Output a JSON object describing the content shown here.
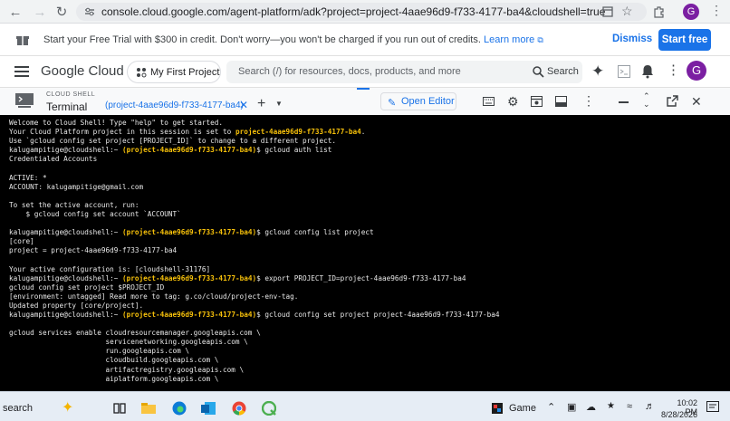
{
  "browser": {
    "url": "console.cloud.google.com/agent-platform/adk?project=project-4aae96d9-f733-4177-ba4&cloudshell=true",
    "profile_initial": "G"
  },
  "banner": {
    "text": "Start your Free Trial with $300 in credit. Don't worry—you won't be charged if you run out of credits.",
    "link": "Learn more",
    "dismiss": "Dismiss",
    "start_free": "Start free"
  },
  "header": {
    "logo": "Google Cloud",
    "project": "My First Project",
    "search_placeholder": "Search (/) for resources, docs, products, and more",
    "search_button": "Search",
    "avatar": "G"
  },
  "shell": {
    "section_label": "CLOUD SHELL",
    "title": "Terminal",
    "tab": "(project-4aae96d9-f733-4177-ba4)",
    "open_editor": "Open Editor"
  },
  "terminal": {
    "l01": "Welcome to Cloud Shell! Type \"help\" to get started.",
    "l02a": "Your Cloud Platform project in this session is set to ",
    "l02b": "project-4aae96d9-f733-4177-ba4",
    "l02c": ".",
    "l03": "Use `gcloud config set project [PROJECT_ID]` to change to a different project.",
    "prompt": "kalugampitige@cloudshell:~",
    "proj_tag": "(project-4aae96d9-f733-4177-ba4)",
    "cmd1": "$ gcloud auth list",
    "l05": "Credentialed Accounts",
    "l07": "ACTIVE: *",
    "l08": "ACCOUNT: kalugampitige@gmail.com",
    "l10": "To set the active account, run:",
    "l11": "    $ gcloud config set account `ACCOUNT`",
    "cmd2": "$ gcloud config list project",
    "l14": "[core]",
    "l15": "project = project-4aae96d9-f733-4177-ba4",
    "l17": "Your active configuration is: [cloudshell-31176]",
    "cmd3": "$ export PROJECT_ID=project-4aae96d9-f733-4177-ba4",
    "l19": "gcloud config set project $PROJECT_ID",
    "l20": "[environment: untagged] Read more to tag: g.co/cloud/project-env-tag.",
    "l21": "Updated property [core/project].",
    "cmd4": "$ gcloud config set project project-4aae96d9-f733-4177-ba4",
    "l24": "gcloud services enable cloudresourcemanager.googleapis.com \\",
    "l25": "                       servicenetworking.googleapis.com \\",
    "l26": "                       run.googleapis.com \\",
    "l27": "                       cloudbuild.googleapis.com \\",
    "l28": "                       artifactregistry.googleapis.com \\",
    "l29": "                       aiplatform.googleapis.com \\"
  },
  "taskbar": {
    "search": "search",
    "game": "Game",
    "time": "10:02 PM",
    "date": "8/28/2026"
  },
  "colors": {
    "accent": "#1a73e8",
    "terminal_bg": "#000000",
    "project_highlight": "#f6c00a"
  }
}
